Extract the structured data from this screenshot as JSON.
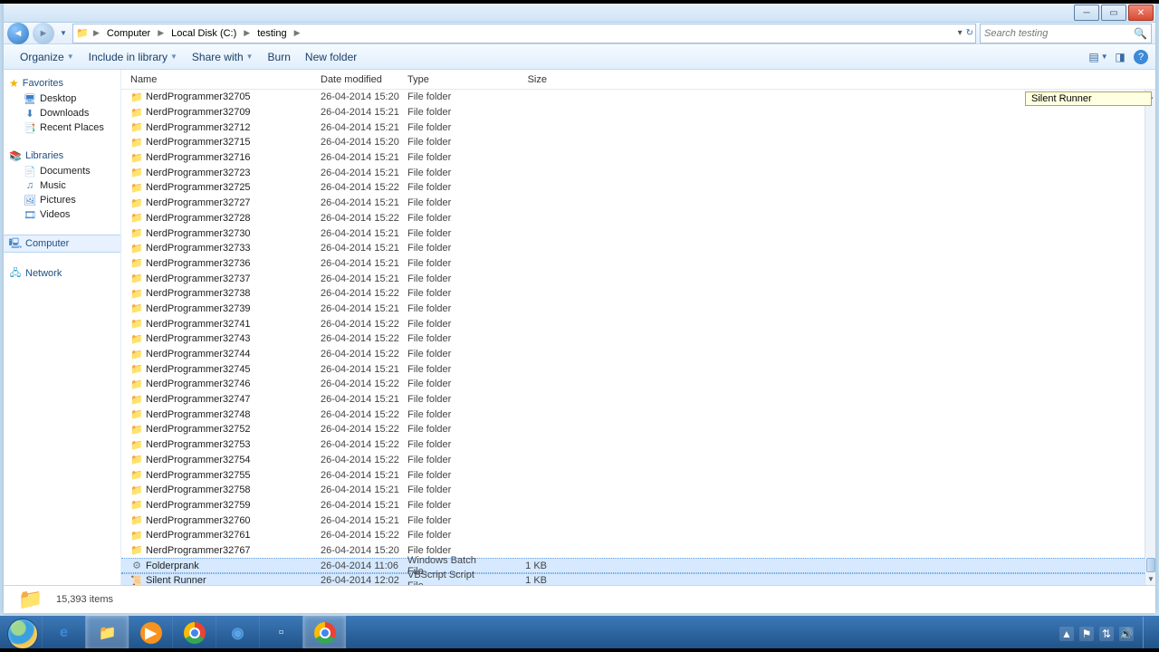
{
  "breadcrumb": {
    "computer": "Computer",
    "disk": "Local Disk (C:)",
    "folder": "testing"
  },
  "search": {
    "placeholder": "Search testing"
  },
  "toolbar": {
    "organize": "Organize",
    "include": "Include in library",
    "share": "Share with",
    "burn": "Burn",
    "newfolder": "New folder"
  },
  "sidebar": {
    "favorites": "Favorites",
    "desktop": "Desktop",
    "downloads": "Downloads",
    "recent": "Recent Places",
    "libraries": "Libraries",
    "documents": "Documents",
    "music": "Music",
    "pictures": "Pictures",
    "videos": "Videos",
    "computer": "Computer",
    "network": "Network"
  },
  "columns": {
    "name": "Name",
    "date": "Date modified",
    "type": "Type",
    "size": "Size"
  },
  "type_folder": "File folder",
  "files": [
    {
      "name": "NerdProgrammer32705",
      "date": "26-04-2014 15:20",
      "type": "File folder",
      "size": "",
      "icon": "folder"
    },
    {
      "name": "NerdProgrammer32709",
      "date": "26-04-2014 15:21",
      "type": "File folder",
      "size": "",
      "icon": "folder"
    },
    {
      "name": "NerdProgrammer32712",
      "date": "26-04-2014 15:21",
      "type": "File folder",
      "size": "",
      "icon": "folder"
    },
    {
      "name": "NerdProgrammer32715",
      "date": "26-04-2014 15:20",
      "type": "File folder",
      "size": "",
      "icon": "folder"
    },
    {
      "name": "NerdProgrammer32716",
      "date": "26-04-2014 15:21",
      "type": "File folder",
      "size": "",
      "icon": "folder"
    },
    {
      "name": "NerdProgrammer32723",
      "date": "26-04-2014 15:21",
      "type": "File folder",
      "size": "",
      "icon": "folder"
    },
    {
      "name": "NerdProgrammer32725",
      "date": "26-04-2014 15:22",
      "type": "File folder",
      "size": "",
      "icon": "folder"
    },
    {
      "name": "NerdProgrammer32727",
      "date": "26-04-2014 15:21",
      "type": "File folder",
      "size": "",
      "icon": "folder"
    },
    {
      "name": "NerdProgrammer32728",
      "date": "26-04-2014 15:22",
      "type": "File folder",
      "size": "",
      "icon": "folder"
    },
    {
      "name": "NerdProgrammer32730",
      "date": "26-04-2014 15:21",
      "type": "File folder",
      "size": "",
      "icon": "folder"
    },
    {
      "name": "NerdProgrammer32733",
      "date": "26-04-2014 15:21",
      "type": "File folder",
      "size": "",
      "icon": "folder"
    },
    {
      "name": "NerdProgrammer32736",
      "date": "26-04-2014 15:21",
      "type": "File folder",
      "size": "",
      "icon": "folder"
    },
    {
      "name": "NerdProgrammer32737",
      "date": "26-04-2014 15:21",
      "type": "File folder",
      "size": "",
      "icon": "folder"
    },
    {
      "name": "NerdProgrammer32738",
      "date": "26-04-2014 15:22",
      "type": "File folder",
      "size": "",
      "icon": "folder"
    },
    {
      "name": "NerdProgrammer32739",
      "date": "26-04-2014 15:21",
      "type": "File folder",
      "size": "",
      "icon": "folder"
    },
    {
      "name": "NerdProgrammer32741",
      "date": "26-04-2014 15:22",
      "type": "File folder",
      "size": "",
      "icon": "folder"
    },
    {
      "name": "NerdProgrammer32743",
      "date": "26-04-2014 15:22",
      "type": "File folder",
      "size": "",
      "icon": "folder"
    },
    {
      "name": "NerdProgrammer32744",
      "date": "26-04-2014 15:22",
      "type": "File folder",
      "size": "",
      "icon": "folder"
    },
    {
      "name": "NerdProgrammer32745",
      "date": "26-04-2014 15:21",
      "type": "File folder",
      "size": "",
      "icon": "folder"
    },
    {
      "name": "NerdProgrammer32746",
      "date": "26-04-2014 15:22",
      "type": "File folder",
      "size": "",
      "icon": "folder"
    },
    {
      "name": "NerdProgrammer32747",
      "date": "26-04-2014 15:21",
      "type": "File folder",
      "size": "",
      "icon": "folder"
    },
    {
      "name": "NerdProgrammer32748",
      "date": "26-04-2014 15:22",
      "type": "File folder",
      "size": "",
      "icon": "folder"
    },
    {
      "name": "NerdProgrammer32752",
      "date": "26-04-2014 15:22",
      "type": "File folder",
      "size": "",
      "icon": "folder"
    },
    {
      "name": "NerdProgrammer32753",
      "date": "26-04-2014 15:22",
      "type": "File folder",
      "size": "",
      "icon": "folder"
    },
    {
      "name": "NerdProgrammer32754",
      "date": "26-04-2014 15:22",
      "type": "File folder",
      "size": "",
      "icon": "folder"
    },
    {
      "name": "NerdProgrammer32755",
      "date": "26-04-2014 15:21",
      "type": "File folder",
      "size": "",
      "icon": "folder"
    },
    {
      "name": "NerdProgrammer32758",
      "date": "26-04-2014 15:21",
      "type": "File folder",
      "size": "",
      "icon": "folder"
    },
    {
      "name": "NerdProgrammer32759",
      "date": "26-04-2014 15:21",
      "type": "File folder",
      "size": "",
      "icon": "folder"
    },
    {
      "name": "NerdProgrammer32760",
      "date": "26-04-2014 15:21",
      "type": "File folder",
      "size": "",
      "icon": "folder"
    },
    {
      "name": "NerdProgrammer32761",
      "date": "26-04-2014 15:22",
      "type": "File folder",
      "size": "",
      "icon": "folder"
    },
    {
      "name": "NerdProgrammer32767",
      "date": "26-04-2014 15:20",
      "type": "File folder",
      "size": "",
      "icon": "folder"
    },
    {
      "name": "Folderprank",
      "date": "26-04-2014 11:06",
      "type": "Windows Batch File",
      "size": "1 KB",
      "icon": "bat",
      "selected": true
    },
    {
      "name": "Silent Runner",
      "date": "26-04-2014 12:02",
      "type": "VBScript Script File",
      "size": "1 KB",
      "icon": "vbs",
      "selected": true
    }
  ],
  "tooltip": "Silent Runner",
  "status": {
    "count": "15,393 items"
  }
}
